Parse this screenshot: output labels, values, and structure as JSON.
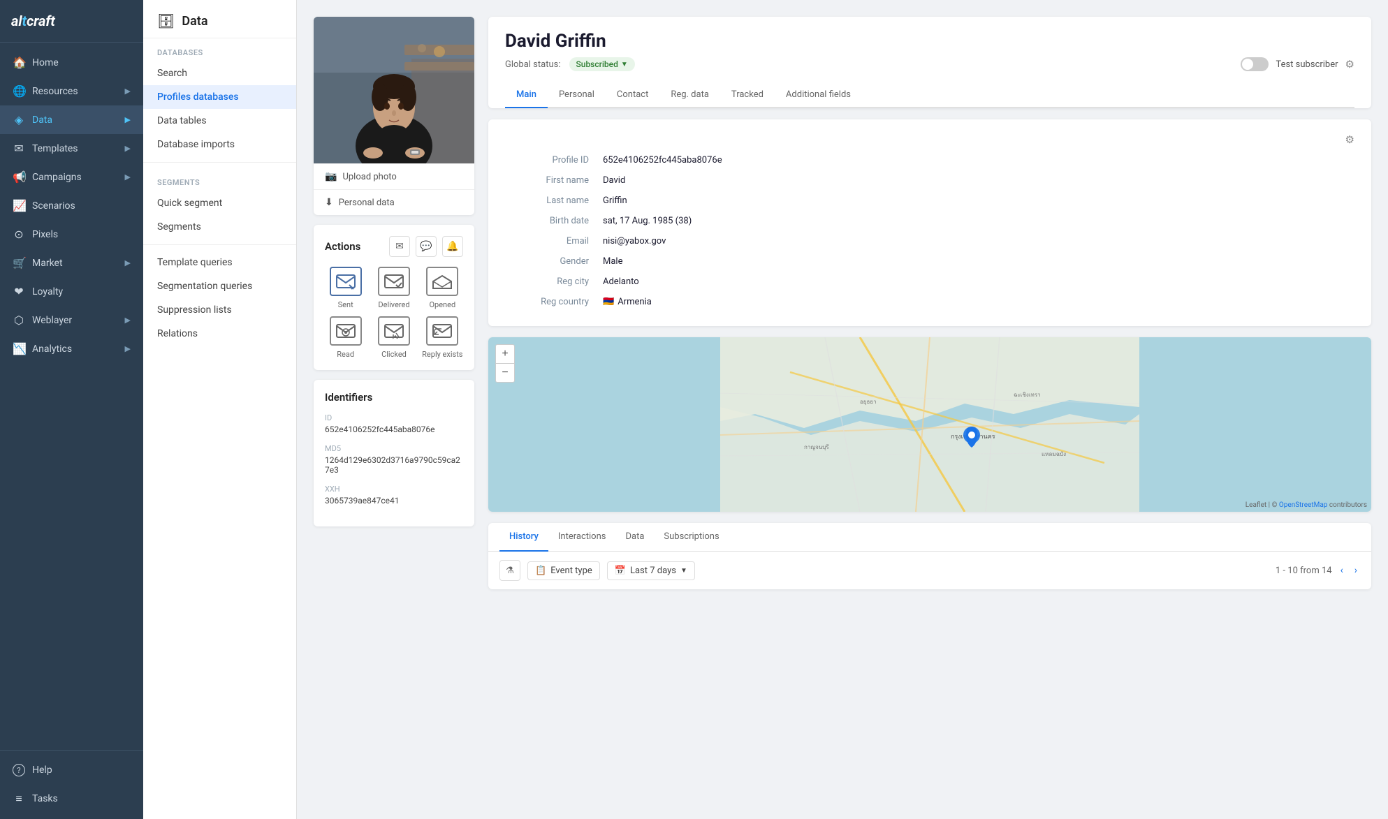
{
  "app": {
    "name": "altcraft",
    "name_colored": "t"
  },
  "sidebar": {
    "items": [
      {
        "id": "home",
        "label": "Home",
        "icon": "🏠",
        "active": false
      },
      {
        "id": "resources",
        "label": "Resources",
        "icon": "🌐",
        "active": false,
        "has_arrow": true
      },
      {
        "id": "data",
        "label": "Data",
        "icon": "📊",
        "active": true,
        "has_arrow": true
      },
      {
        "id": "templates",
        "label": "Templates",
        "icon": "✉",
        "active": false,
        "has_arrow": true
      },
      {
        "id": "campaigns",
        "label": "Campaigns",
        "icon": "📢",
        "active": false,
        "has_arrow": true
      },
      {
        "id": "scenarios",
        "label": "Scenarios",
        "icon": "📈",
        "active": false
      },
      {
        "id": "pixels",
        "label": "Pixels",
        "icon": "⊙",
        "active": false
      },
      {
        "id": "market",
        "label": "Market",
        "icon": "🛒",
        "active": false,
        "has_arrow": true
      },
      {
        "id": "loyalty",
        "label": "Loyalty",
        "icon": "❤",
        "active": false
      },
      {
        "id": "weblayer",
        "label": "Weblayer",
        "icon": "☰",
        "active": false,
        "has_arrow": true
      },
      {
        "id": "analytics",
        "label": "Analytics",
        "icon": "📉",
        "active": false,
        "has_arrow": true
      }
    ],
    "bottom_items": [
      {
        "id": "help",
        "label": "Help",
        "icon": "?"
      },
      {
        "id": "tasks",
        "label": "Tasks",
        "icon": "≡"
      }
    ]
  },
  "left_panel": {
    "icon": "🗄",
    "title": "Data",
    "sections": [
      {
        "label": "Databases",
        "items": [
          {
            "id": "search",
            "label": "Search",
            "active": false
          },
          {
            "id": "profiles-databases",
            "label": "Profiles databases",
            "active": true
          },
          {
            "id": "data-tables",
            "label": "Data tables",
            "active": false
          },
          {
            "id": "database-imports",
            "label": "Database imports",
            "active": false
          }
        ]
      },
      {
        "label": "Segments",
        "items": [
          {
            "id": "quick-segment",
            "label": "Quick segment",
            "active": false
          },
          {
            "id": "segments",
            "label": "Segments",
            "active": false
          }
        ]
      },
      {
        "label": "",
        "items": [
          {
            "id": "template-queries",
            "label": "Template queries",
            "active": false
          },
          {
            "id": "segmentation-queries",
            "label": "Segmentation queries",
            "active": false
          },
          {
            "id": "suppression-lists",
            "label": "Suppression lists",
            "active": false
          },
          {
            "id": "relations",
            "label": "Relations",
            "active": false
          }
        ]
      }
    ]
  },
  "profile": {
    "name": "David Griffin",
    "global_status_label": "Global status:",
    "status": "Subscribed",
    "test_subscriber_label": "Test subscriber",
    "tabs": [
      "Main",
      "Personal",
      "Contact",
      "Reg. data",
      "Tracked",
      "Additional fields"
    ],
    "active_tab": "Main",
    "fields": {
      "profile_id_label": "Profile ID",
      "profile_id_value": "652e4106252fc445aba8076e",
      "first_name_label": "First name",
      "first_name_value": "David",
      "last_name_label": "Last name",
      "last_name_value": "Griffin",
      "birth_date_label": "Birth date",
      "birth_date_value": "sat, 17 Aug. 1985 (38)",
      "email_label": "Email",
      "email_value": "nisi@yabox.gov",
      "gender_label": "Gender",
      "gender_value": "Male",
      "reg_city_label": "Reg city",
      "reg_city_value": "Adelanto",
      "reg_country_label": "Reg country",
      "reg_country_value": "Armenia",
      "reg_country_flag": "🇦🇲"
    },
    "actions": {
      "title": "Actions",
      "items": [
        {
          "id": "sent",
          "label": "Sent",
          "active": true
        },
        {
          "id": "delivered",
          "label": "Delivered",
          "active": false
        },
        {
          "id": "opened",
          "label": "Opened",
          "active": false
        },
        {
          "id": "read",
          "label": "Read",
          "active": false
        },
        {
          "id": "clicked",
          "label": "Clicked",
          "active": false
        },
        {
          "id": "reply-exists",
          "label": "Reply exists",
          "active": false
        }
      ]
    },
    "identifiers": {
      "title": "Identifiers",
      "items": [
        {
          "label": "ID",
          "value": "652e4106252fc445aba8076e"
        },
        {
          "label": "MD5",
          "value": "1264d129e6302d3716a9790c59ca27e3"
        },
        {
          "label": "XXH",
          "value": "3065739ae847ce41"
        }
      ]
    },
    "bottom_tabs": [
      "History",
      "Interactions",
      "Data",
      "Subscriptions"
    ],
    "active_bottom_tab": "History",
    "history": {
      "event_type_label": "Event type",
      "date_range_label": "Last 7 days",
      "pagination": "1 - 10 from 14"
    }
  },
  "photo": {
    "upload_label": "Upload photo",
    "personal_data_label": "Personal data"
  }
}
